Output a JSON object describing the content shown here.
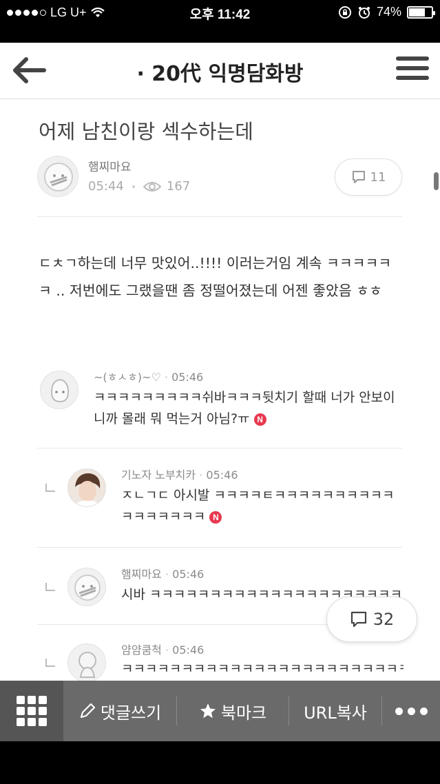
{
  "status_bar": {
    "carrier": "LG U+",
    "time": "오후 11:42",
    "battery": "74%",
    "battery_level": 0.74
  },
  "nav": {
    "title": "· 20代 익명담화방",
    "back_icon": "arrow-left-icon",
    "menu_icon": "hamburger-menu-icon"
  },
  "post": {
    "title": "어제 남친이랑 섹수하는데",
    "author": "햄찌마요",
    "time": "05:44",
    "views": "167",
    "comment_count": "11",
    "body": "ㄷㅊㄱ하는데 너무 맛있어..!!!! 이러는거임 계속 ㅋㅋㅋㅋㅋㅋ .. 저번에도 그랬을땐 좀 정떨어졌는데 어젠 좋았음 ㅎㅎ"
  },
  "comments": [
    {
      "author": "~(ㅎㅅㅎ)~♡",
      "time": "05:46",
      "text": "ㅋㅋㅋㅋㅋㅋㅋㅋㅋ쉬바ㅋㅋㅋ뒷치기 할때 너가 안보이니까 몰래 뭐 먹는거 아님?ㅠ",
      "badge": "N"
    },
    {
      "author": "기노자 노부치카",
      "time": "05:46",
      "text": "ㅈㄴㄱㄷ 아시발 ㅋㅋㅋㅋㅌㅋㅋㅋㅋㅋㅋㅋㅋㅋㅋㅋㅋㅋㅋㅋㅋㅋ",
      "badge": "N",
      "reply": true
    },
    {
      "author": "햄찌마요",
      "time": "05:46",
      "text": "시바 ㅋㅋㅋㅋㅋㅋㅋㅋㅋㅋㅋㅋㅋㅋㅋㅋㅋㅋㅋㅋㅋㅋ",
      "reply": true
    },
    {
      "author": "얌얌쿰척",
      "time": "05:46",
      "text": "ㅋㅋㅋㅋㅋㅋㅋㅋㅋㅋㅋㅋㅋㅋㅋㅋㅋㅋㅋㅋㅋㅋㅋㅋㅋㅋ",
      "reply": true
    }
  ],
  "floating_comment_count": "32",
  "toolbar": {
    "write_comment": "댓글쓰기",
    "bookmark": "북마크",
    "copy_url": "URL복사"
  },
  "colors": {
    "toolbar_bg": "#6a6a6a",
    "toolbar_grid_bg": "#555555",
    "badge_red": "#e8384f"
  }
}
